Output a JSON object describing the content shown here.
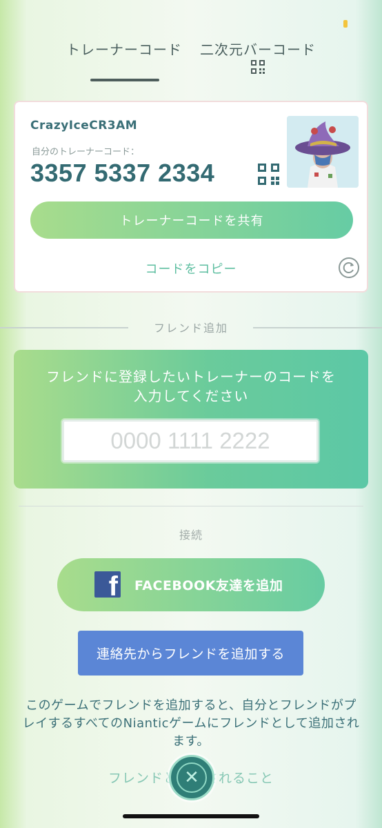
{
  "colors": {
    "accent": "#66cca4",
    "text_teal": "#3a6f77",
    "contacts_blue": "#5b86d6",
    "facebook_blue": "#3b5998"
  },
  "tabs": [
    {
      "label": "トレーナーコード",
      "active": true
    },
    {
      "label": "二次元バーコード",
      "active": false,
      "icon": "qr-code-icon"
    }
  ],
  "trainer": {
    "username": "CrazyIceCR3AM",
    "code_label": "自分のトレーナーコード：",
    "code": "3357 5337 2334",
    "share_label": "トレーナーコードを共有",
    "copy_label": "コードをコピー"
  },
  "friend_add": {
    "section_label": "フレンド追加",
    "instruction": "フレンドに登録したいトレーナーのコードを入力してください",
    "placeholder": "0000 1111 2222"
  },
  "connect": {
    "section_label": "接続",
    "facebook_label": "FACEBOOK友達を追加",
    "contacts_label": "連絡先からフレンドを追加する",
    "info_text": "このゲームでフレンドを追加すると、自分とフレンドがプレイするすべてのNianticゲームにフレンドとして追加されます。",
    "bottom_link": "フレンドと　　されること"
  }
}
